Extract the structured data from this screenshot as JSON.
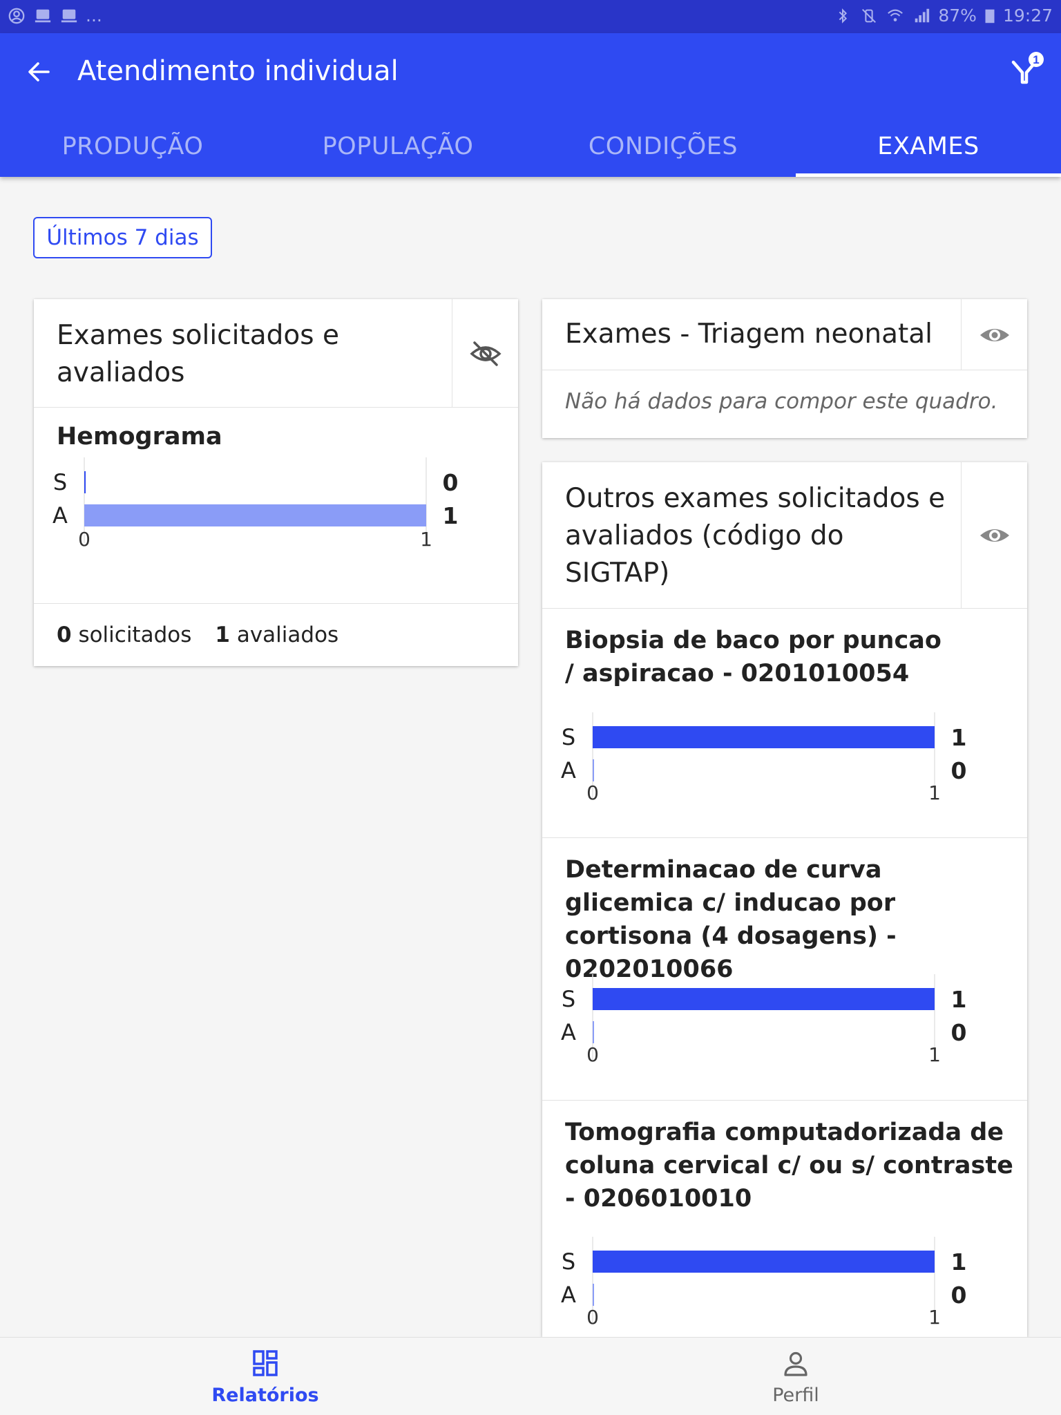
{
  "status_bar": {
    "battery": "87%",
    "time": "19:27",
    "more": "..."
  },
  "app_bar": {
    "title": "Atendimento individual",
    "back_icon": "arrow-left-icon",
    "filter_icon": "filter-icon",
    "filter_badge": "1"
  },
  "tabs": [
    {
      "label": "PRODUÇÃO",
      "active": false
    },
    {
      "label": "POPULAÇÃO",
      "active": false
    },
    {
      "label": "CONDIÇÕES",
      "active": false
    },
    {
      "label": "EXAMES",
      "active": true
    }
  ],
  "period_chip": "Últimos 7 dias",
  "cards": {
    "solicitados_avaliados": {
      "title": "Exames solicitados e avaliados",
      "visibility_icon": "eye-off-icon",
      "summary": {
        "solicitados_value": "0",
        "solicitados_label": "solicitados",
        "avaliados_value": "1",
        "avaliados_label": "avaliados"
      }
    },
    "triagem_neonatal": {
      "title": "Exames - Triagem neonatal",
      "visibility_icon": "eye-icon",
      "empty_message": "Não há dados para compor este quadro."
    },
    "outros_exames": {
      "title": "Outros exames solicitados e avaliados (código do SIGTAP)",
      "visibility_icon": "eye-icon"
    }
  },
  "chart_data": [
    {
      "type": "bar",
      "orientation": "horizontal",
      "title": "Hemograma",
      "categories": [
        "S",
        "A"
      ],
      "values": [
        0,
        1
      ],
      "xlim": [
        0,
        1
      ],
      "x_ticks": [
        "0",
        "1"
      ],
      "colors": [
        "#2f4af2",
        "#8a9cf7"
      ]
    },
    {
      "type": "bar",
      "orientation": "horizontal",
      "title": "Biopsia de baco por puncao / aspiracao - 0201010054",
      "categories": [
        "S",
        "A"
      ],
      "values": [
        1,
        0
      ],
      "xlim": [
        0,
        1
      ],
      "x_ticks": [
        "0",
        "1"
      ],
      "colors": [
        "#2f4af2",
        "#8a9cf7"
      ]
    },
    {
      "type": "bar",
      "orientation": "horizontal",
      "title": "Determinacao de curva glicemica c/ inducao por cortisona (4 dosagens) - 0202010066",
      "categories": [
        "S",
        "A"
      ],
      "values": [
        1,
        0
      ],
      "xlim": [
        0,
        1
      ],
      "x_ticks": [
        "0",
        "1"
      ],
      "colors": [
        "#2f4af2",
        "#8a9cf7"
      ]
    },
    {
      "type": "bar",
      "orientation": "horizontal",
      "title": "Tomografia computadorizada de coluna cervical c/ ou s/ contraste - 0206010010",
      "categories": [
        "S",
        "A"
      ],
      "values": [
        1,
        0
      ],
      "xlim": [
        0,
        1
      ],
      "x_ticks": [
        "0",
        "1"
      ],
      "colors": [
        "#2f4af2",
        "#8a9cf7"
      ]
    }
  ],
  "bottom_nav": [
    {
      "label": "Relatórios",
      "icon": "dashboard-icon",
      "active": true
    },
    {
      "label": "Perfil",
      "icon": "person-icon",
      "active": false
    }
  ]
}
